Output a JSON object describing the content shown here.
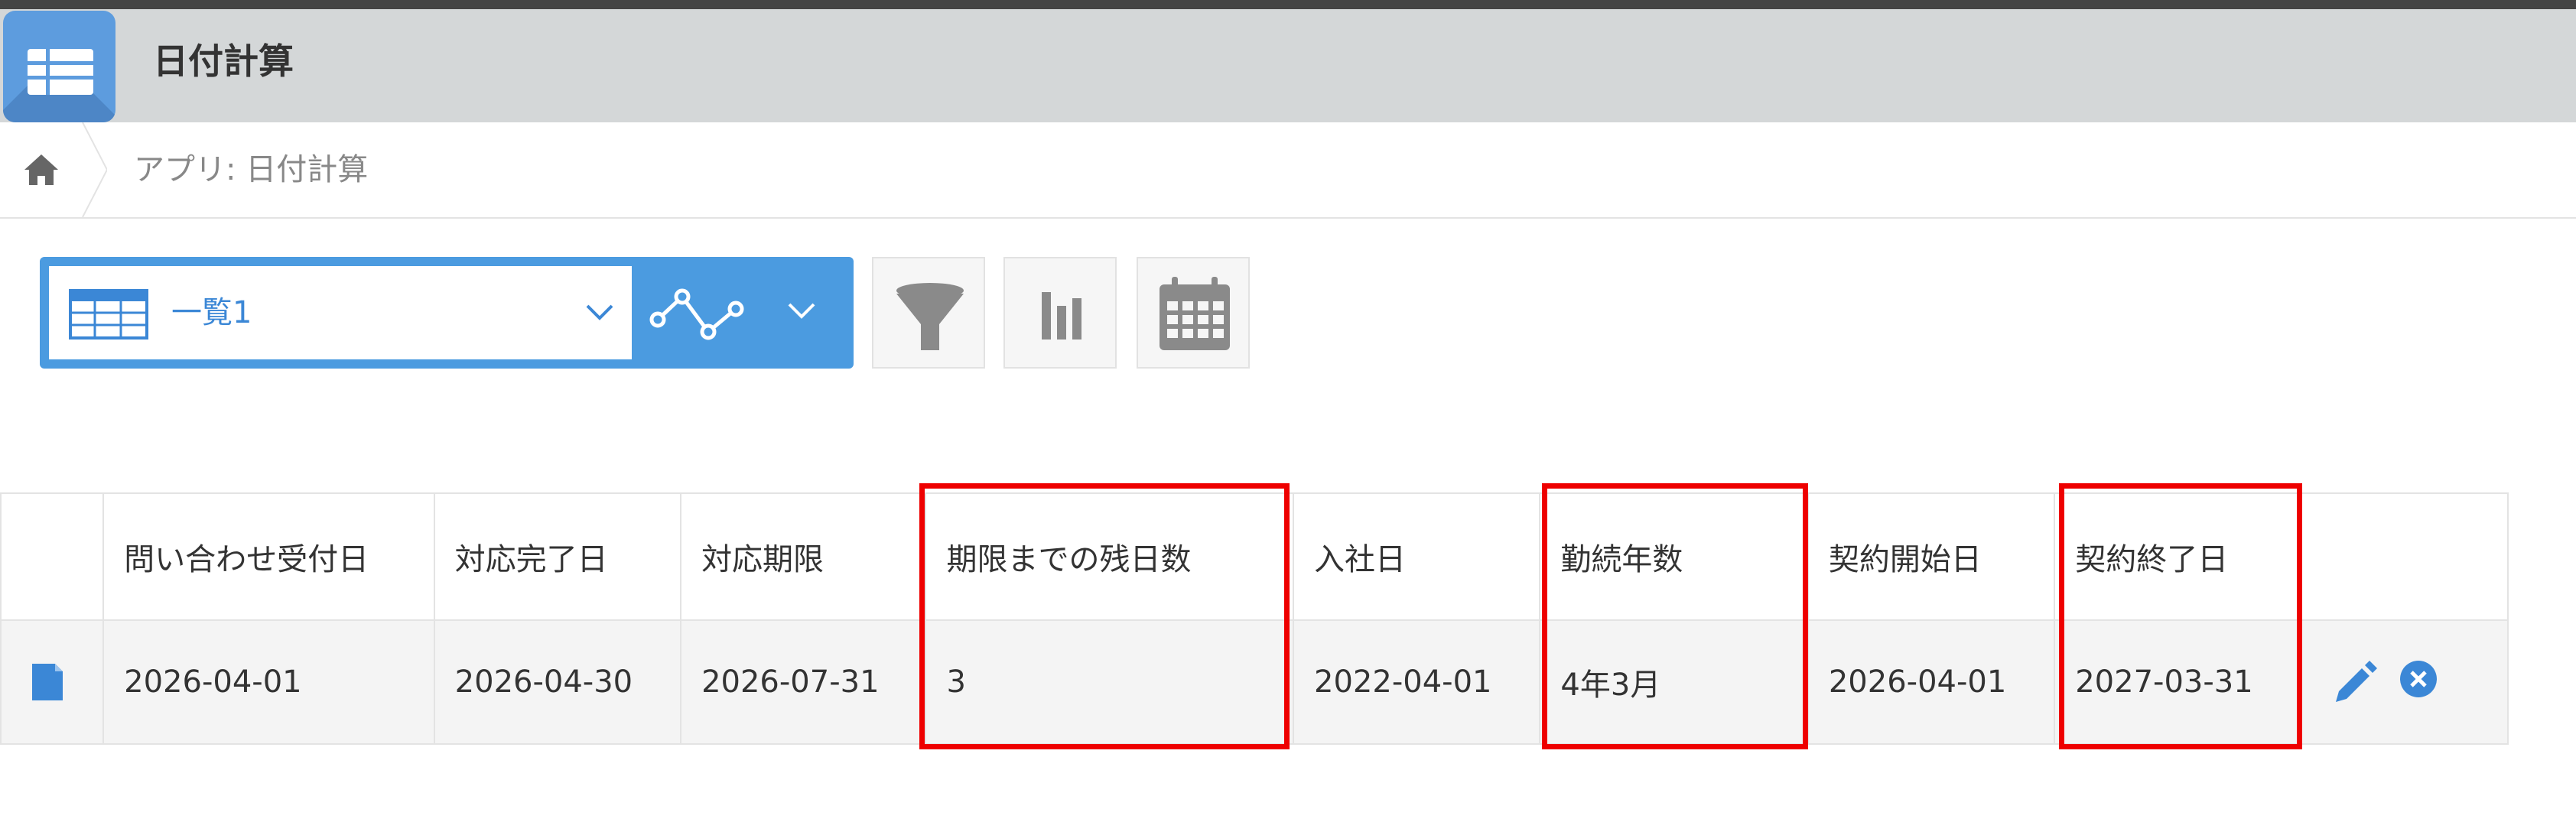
{
  "header": {
    "app_title": "日付計算",
    "icon": "list-app-icon"
  },
  "breadcrumb": {
    "home_icon": "home-icon",
    "label": "アプリ: 日付計算"
  },
  "toolbar": {
    "view_name": "一覧1",
    "view_icon": "table-view-icon",
    "graph_icon": "graph-icon",
    "filter_icon": "filter-icon",
    "chart_icon": "bar-chart-icon",
    "calendar_icon": "calendar-icon"
  },
  "table": {
    "columns": [
      "問い合わせ受付日",
      "対応完了日",
      "対応期限",
      "期限までの残日数",
      "入社日",
      "勤続年数",
      "契約開始日",
      "契約終了日"
    ],
    "rows": [
      {
        "cells": [
          "2026-04-01",
          "2026-04-30",
          "2026-07-31",
          "3",
          "2022-04-01",
          "4年3月",
          "2026-04-01",
          "2027-03-31"
        ],
        "row_icon": "record-detail-icon",
        "edit_icon": "pencil-icon",
        "delete_icon": "close-circle-icon"
      }
    ]
  },
  "highlight_color": "#ee0000",
  "accent_color": "#4b9be0"
}
